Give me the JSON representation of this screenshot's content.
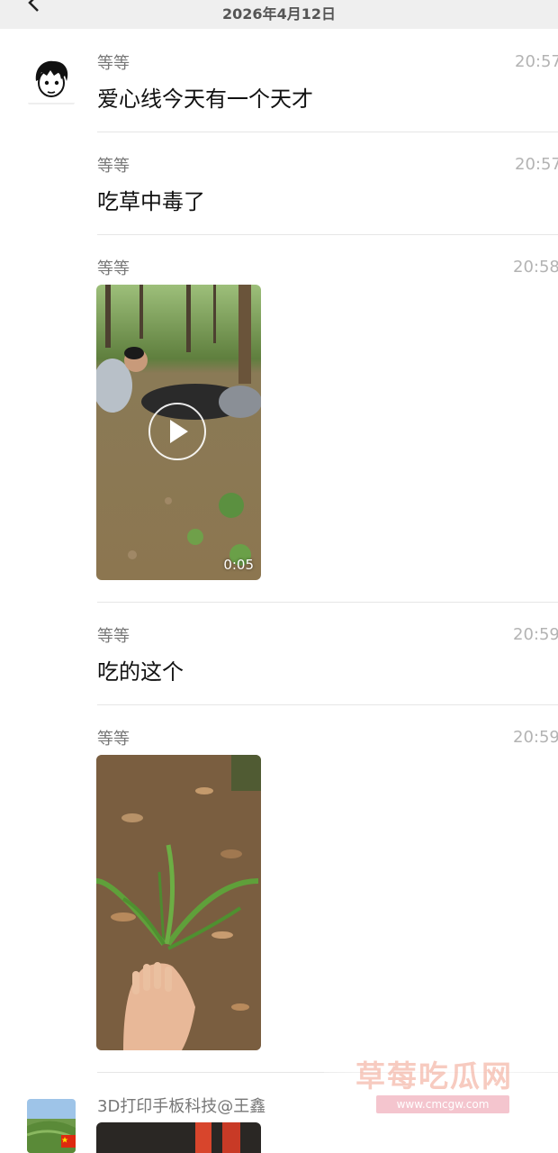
{
  "header": {
    "date": "2026年4月12日"
  },
  "messages": [
    {
      "sender": "等等",
      "time": "20:57",
      "text": "爱心线今天有一个天才"
    },
    {
      "sender": "等等",
      "time": "20:57",
      "text": "吃草中毒了"
    },
    {
      "sender": "等等",
      "time": "20:58",
      "video_duration": "0:05"
    },
    {
      "sender": "等等",
      "time": "20:59",
      "text": "吃的这个"
    },
    {
      "sender": "等等",
      "time": "20:59"
    },
    {
      "sender": "3D打印手板科技@王鑫"
    }
  ],
  "watermark": {
    "title": "草莓吃瓜网",
    "url": "www.cmcgw.com"
  },
  "icons": [
    "back-icon",
    "play-icon",
    "flag-icon"
  ]
}
